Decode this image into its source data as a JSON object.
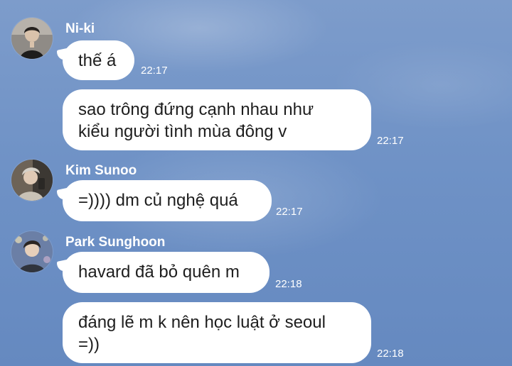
{
  "messages": [
    {
      "sender": "Ni-ki",
      "avatar_icon": "profile-photo-niki",
      "bubbles": [
        {
          "text": "thế á",
          "time": "22:17"
        },
        {
          "lines": [
            "sao trông đứng cạnh nhau như",
            "kiểu người tình mùa đông v"
          ],
          "time": "22:17"
        }
      ]
    },
    {
      "sender": "Kim Sunoo",
      "avatar_icon": "profile-photo-sunoo",
      "bubbles": [
        {
          "text": "=)))) dm củ nghệ quá",
          "time": "22:17"
        }
      ]
    },
    {
      "sender": "Park Sunghoon",
      "avatar_icon": "profile-photo-sunghoon",
      "bubbles": [
        {
          "text": "havard đã bỏ quên m",
          "time": "22:18"
        },
        {
          "lines": [
            "đáng lẽ m k nên học luật ở seoul",
            "=))"
          ],
          "time": "22:18"
        }
      ]
    }
  ],
  "colors": {
    "background": "#6f92c6",
    "bubble": "#ffffff",
    "text": "#1e1e1e",
    "sender_name": "#ffffff",
    "timestamp": "#ffffff"
  }
}
